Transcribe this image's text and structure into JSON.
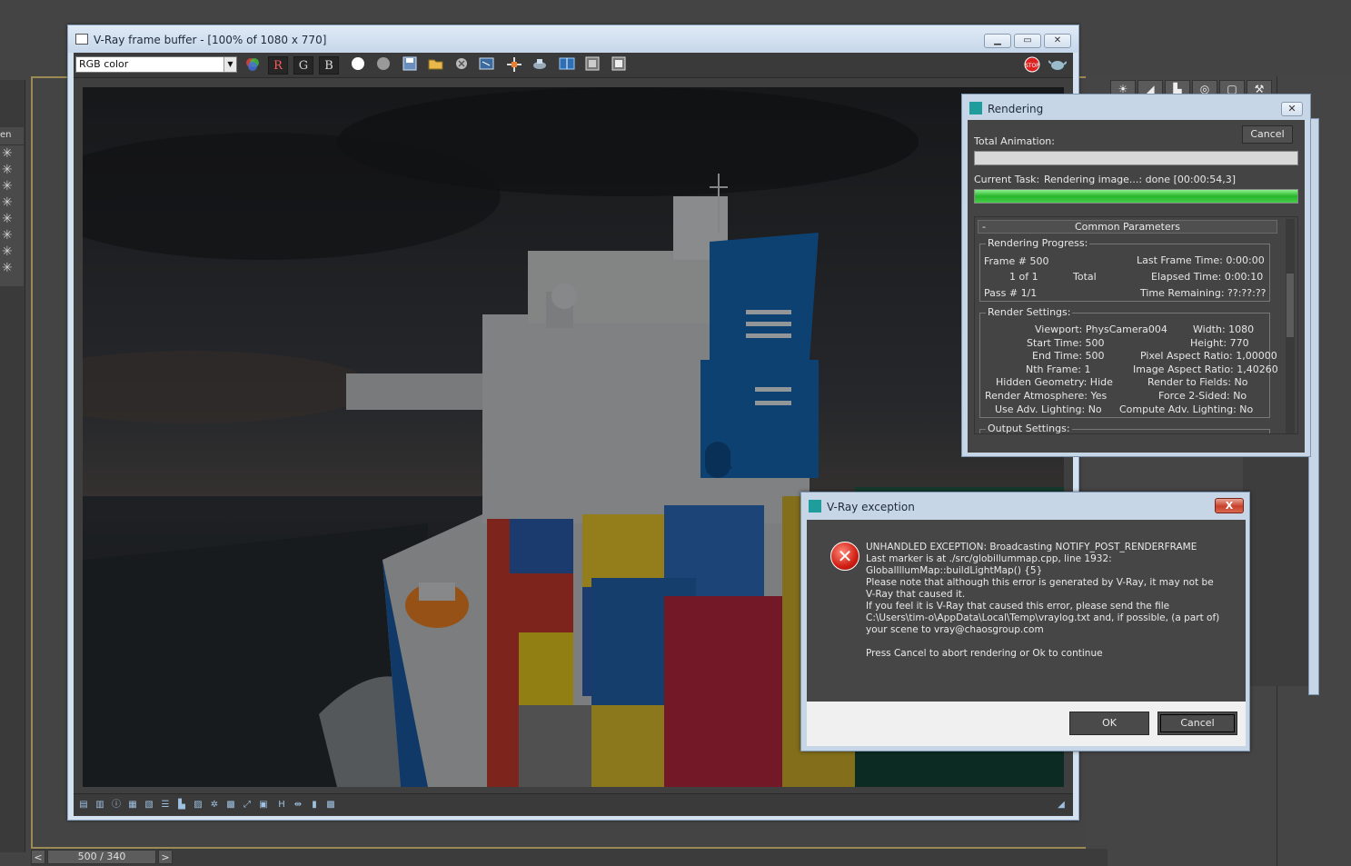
{
  "vfb": {
    "title": "V-Ray frame buffer - [100% of 1080 x 770]",
    "channel": "RGB color",
    "btn_r": "R",
    "btn_g": "G",
    "btn_b": "B",
    "stop_label": "STOP"
  },
  "max": {
    "leftpanel_head": "en",
    "timeline_prev": "<",
    "timeline_next": ">",
    "timeline_label": "500 / 340"
  },
  "rendering": {
    "title": "Rendering",
    "cancel": "Cancel",
    "total_animation_label": "Total Animation:",
    "total_animation_progress": 0,
    "current_task_label": "Current Task:",
    "current_task_value": "Rendering image...: done [00:00:54,3]",
    "current_task_progress": 1.0,
    "rollout_minus": "-",
    "rollout_title": "Common Parameters",
    "progress_group": "Rendering Progress:",
    "frame_label": "Frame #",
    "frame_value": "500",
    "of_label": "1 of 1",
    "total_label": "Total",
    "pass_label": "Pass #",
    "pass_value": "1/1",
    "last_frame_time_label": "Last Frame Time:",
    "last_frame_time_value": "0:00:00",
    "elapsed_time_label": "Elapsed Time:",
    "elapsed_time_value": "0:00:10",
    "time_remaining_label": "Time Remaining:",
    "time_remaining_value": "??:??:??",
    "settings_group": "Render Settings:",
    "viewport_label": "Viewport:",
    "viewport_value": "PhysCamera004",
    "start_time_label": "Start Time:",
    "start_time_value": "500",
    "end_time_label": "End Time:",
    "end_time_value": "500",
    "nth_frame_label": "Nth Frame:",
    "nth_frame_value": "1",
    "hidden_geometry_label": "Hidden Geometry:",
    "hidden_geometry_value": "Hide",
    "render_atmosphere_label": "Render Atmosphere:",
    "render_atmosphere_value": "Yes",
    "use_adv_lighting_label": "Use Adv. Lighting:",
    "use_adv_lighting_value": "No",
    "width_label": "Width:",
    "width_value": "1080",
    "height_label": "Height:",
    "height_value": "770",
    "pixel_aspect_label": "Pixel Aspect Ratio:",
    "pixel_aspect_value": "1,00000",
    "image_aspect_label": "Image Aspect Ratio:",
    "image_aspect_value": "1,40260",
    "render_fields_label": "Render to Fields:",
    "render_fields_value": "No",
    "force_2sided_label": "Force 2-Sided:",
    "force_2sided_value": "No",
    "compute_adv_label": "Compute Adv. Lighting:",
    "compute_adv_value": "No",
    "output_group": "Output Settings:"
  },
  "exception": {
    "title": "V-Ray exception",
    "close": "X",
    "error_glyph": "✕",
    "message": "UNHANDLED EXCEPTION: Broadcasting NOTIFY_POST_RENDERFRAME\nLast marker is at ./src/globillummap.cpp, line 1932:\nGlobalIllumMap::buildLightMap() {5}\nPlease note that although this error is generated by V-Ray, it may not be\nV-Ray that caused it.\nIf you feel it is V-Ray that caused this error, please send the file\nC:\\Users\\tim-o\\AppData\\Local\\Temp\\vraylog.txt and, if possible, (a part of)\nyour scene to vray@chaosgroup.com\n\nPress Cancel to abort rendering or Ok to continue",
    "ok": "OK",
    "cancel": "Cancel"
  },
  "colors": {
    "progress_green": "#27b62b",
    "error_red": "#d11f14",
    "ship_blue": "#1565b0"
  }
}
